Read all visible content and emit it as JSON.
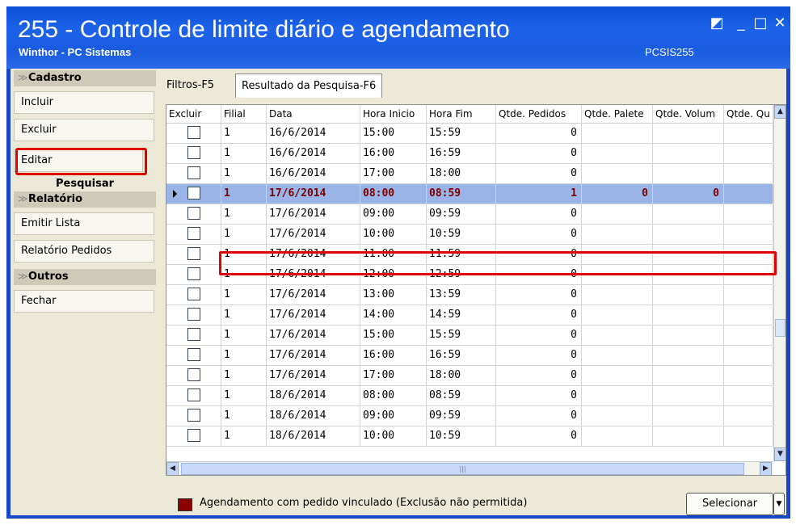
{
  "window": {
    "title": "255 - Controle de limite diário e agendamento",
    "subtitle": "Winthor - PC Sistemas",
    "code": "PCSIS255",
    "controls": {
      "restore": "◩",
      "minimize": "_",
      "maximize": "□",
      "close": "✕"
    }
  },
  "sidebar": {
    "sections": [
      {
        "title": "Cadastro",
        "items": [
          "Incluir",
          "Excluir",
          "Editar"
        ],
        "extra": "Pesquisar"
      },
      {
        "title": "Relatório",
        "items": [
          "Emitir Lista",
          "Relatório Pedidos"
        ]
      },
      {
        "title": "Outros",
        "items": [
          "Fechar"
        ]
      }
    ],
    "chevron": "≫"
  },
  "tabs": [
    "Filtros-F5",
    "Resultado da Pesquisa-F6"
  ],
  "grid": {
    "columns": [
      "Excluir",
      "Filial",
      "Data",
      "Hora Inicio",
      "Hora Fim",
      "Qtde. Pedidos",
      "Qtde. Palete",
      "Qtde. Volum",
      "Qtde. Qu"
    ],
    "rows": [
      {
        "filial": "1",
        "data": "16/6/2014",
        "inicio": "15:00",
        "fim": "15:59",
        "pedidos": "0",
        "palete": "",
        "volum": ""
      },
      {
        "filial": "1",
        "data": "16/6/2014",
        "inicio": "16:00",
        "fim": "16:59",
        "pedidos": "0",
        "palete": "",
        "volum": ""
      },
      {
        "filial": "1",
        "data": "16/6/2014",
        "inicio": "17:00",
        "fim": "18:00",
        "pedidos": "0",
        "palete": "",
        "volum": ""
      },
      {
        "filial": "1",
        "data": "17/6/2014",
        "inicio": "08:00",
        "fim": "08:59",
        "pedidos": "1",
        "palete": "0",
        "volum": "0"
      },
      {
        "filial": "1",
        "data": "17/6/2014",
        "inicio": "09:00",
        "fim": "09:59",
        "pedidos": "0",
        "palete": "",
        "volum": ""
      },
      {
        "filial": "1",
        "data": "17/6/2014",
        "inicio": "10:00",
        "fim": "10:59",
        "pedidos": "0",
        "palete": "",
        "volum": ""
      },
      {
        "filial": "1",
        "data": "17/6/2014",
        "inicio": "11:00",
        "fim": "11:59",
        "pedidos": "0",
        "palete": "",
        "volum": ""
      },
      {
        "filial": "1",
        "data": "17/6/2014",
        "inicio": "12:00",
        "fim": "12:59",
        "pedidos": "0",
        "palete": "",
        "volum": ""
      },
      {
        "filial": "1",
        "data": "17/6/2014",
        "inicio": "13:00",
        "fim": "13:59",
        "pedidos": "0",
        "palete": "",
        "volum": ""
      },
      {
        "filial": "1",
        "data": "17/6/2014",
        "inicio": "14:00",
        "fim": "14:59",
        "pedidos": "0",
        "palete": "",
        "volum": ""
      },
      {
        "filial": "1",
        "data": "17/6/2014",
        "inicio": "15:00",
        "fim": "15:59",
        "pedidos": "0",
        "palete": "",
        "volum": ""
      },
      {
        "filial": "1",
        "data": "17/6/2014",
        "inicio": "16:00",
        "fim": "16:59",
        "pedidos": "0",
        "palete": "",
        "volum": ""
      },
      {
        "filial": "1",
        "data": "17/6/2014",
        "inicio": "17:00",
        "fim": "18:00",
        "pedidos": "0",
        "palete": "",
        "volum": ""
      },
      {
        "filial": "1",
        "data": "18/6/2014",
        "inicio": "08:00",
        "fim": "08:59",
        "pedidos": "0",
        "palete": "",
        "volum": ""
      },
      {
        "filial": "1",
        "data": "18/6/2014",
        "inicio": "09:00",
        "fim": "09:59",
        "pedidos": "0",
        "palete": "",
        "volum": ""
      },
      {
        "filial": "1",
        "data": "18/6/2014",
        "inicio": "10:00",
        "fim": "10:59",
        "pedidos": "0",
        "palete": "",
        "volum": ""
      }
    ],
    "selected_row": 3
  },
  "legend": {
    "text": "Agendamento com pedido vinculado (Exclusão não permitida)",
    "color": "#8b0000"
  },
  "buttons": {
    "selecionar": "Selecionar",
    "dropdown": "▼"
  },
  "scroll": {
    "up": "▲",
    "down": "▼",
    "left": "◀",
    "right": "▶",
    "grip": "⁞",
    "hgrip": "|||"
  },
  "colors": {
    "titlebar": "#1547c8",
    "selected_row": "#9ab4e8",
    "highlight": "#e00000"
  }
}
